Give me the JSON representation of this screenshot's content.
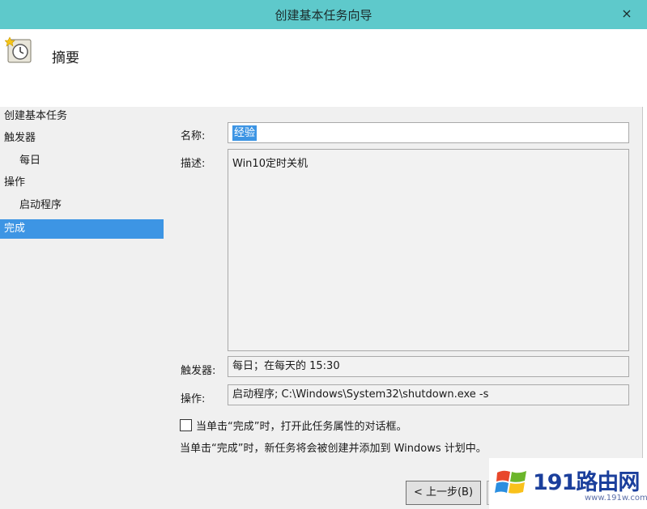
{
  "window": {
    "title": "创建基本任务向导",
    "close_glyph": "×"
  },
  "header": {
    "title": "摘要",
    "icon": "task-clock-icon"
  },
  "nav": {
    "items": [
      {
        "label": "创建基本任务",
        "level": 0,
        "active": false
      },
      {
        "label": "触发器",
        "level": 0,
        "active": false
      },
      {
        "label": "每日",
        "level": 1,
        "active": false
      },
      {
        "label": "操作",
        "level": 0,
        "active": false
      },
      {
        "label": "启动程序",
        "level": 1,
        "active": false
      },
      {
        "label": "完成",
        "level": 0,
        "active": true
      }
    ]
  },
  "form": {
    "name_label": "名称:",
    "name_value": "经验",
    "desc_label": "描述:",
    "desc_value": "Win10定时关机",
    "trigger_label": "触发器:",
    "trigger_value": "每日；在每天的 15:30",
    "action_label": "操作:",
    "action_value": "启动程序; C:\\Windows\\System32\\shutdown.exe -s"
  },
  "options": {
    "open_props_checked": false,
    "open_props_label": "当单击“完成”时，打开此任务属性的对话框。",
    "info_text": "当单击“完成”时，新任务将会被创建并添加到 Windows 计划中。"
  },
  "buttons": {
    "back_label": "< 上一步(B)"
  },
  "watermark": {
    "text": "191路由网",
    "sub": "www.191w.com"
  },
  "colors": {
    "titlebar": "#5ec9cb",
    "accent": "#3d95e4"
  }
}
